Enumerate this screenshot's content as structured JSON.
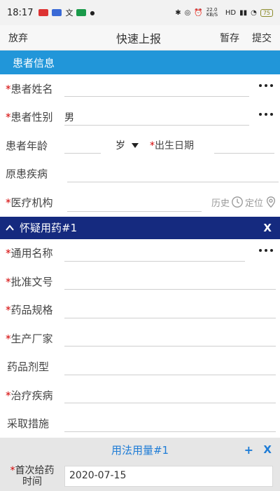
{
  "status_bar": {
    "time": "18:17",
    "network": "HD",
    "speed": "22.0 KB/S",
    "battery": "75"
  },
  "topbar": {
    "cancel": "放弃",
    "title": "快速上报",
    "save": "暂存",
    "submit": "提交"
  },
  "patient_section": {
    "title": "患者信息",
    "name_label": "患者姓名",
    "gender_label": "患者性别",
    "gender_value": "男",
    "age_label": "患者年龄",
    "age_unit": "岁",
    "birth_label": "出生日期",
    "disease_label": "原患疾病",
    "institution_label": "医疗机构",
    "history_label": "历史",
    "locate_label": "定位"
  },
  "drug_section": {
    "title": "怀疑用药#1",
    "close": "X",
    "generic_name_label": "通用名称",
    "approval_label": "批准文号",
    "spec_label": "药品规格",
    "manufacturer_label": "生产厂家",
    "dosage_form_label": "药品剂型",
    "treat_disease_label": "治疗疾病",
    "measures_label": "采取措施"
  },
  "usage_section": {
    "title": "用法用量#1",
    "add": "+",
    "close": "X",
    "first_dose_label_1": "首次给药",
    "first_dose_label_2": "时间",
    "first_dose_value": "2020-07-15"
  },
  "required_mark": "*"
}
